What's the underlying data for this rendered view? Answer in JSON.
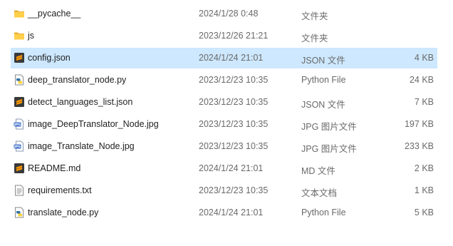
{
  "files": [
    {
      "name": "__pycache__",
      "date": "2024/1/28 0:48",
      "type": "文件夹",
      "size": "",
      "icon": "folder-icon",
      "selected": false
    },
    {
      "name": "js",
      "date": "2023/12/26 21:21",
      "type": "文件夹",
      "size": "",
      "icon": "folder-icon",
      "selected": false
    },
    {
      "name": "config.json",
      "date": "2024/1/24 21:01",
      "type": "JSON 文件",
      "size": "4 KB",
      "icon": "sublime-file-icon",
      "selected": true
    },
    {
      "name": "deep_translator_node.py",
      "date": "2023/12/23 10:35",
      "type": "Python File",
      "size": "24 KB",
      "icon": "python-file-icon",
      "selected": false
    },
    {
      "name": "detect_languages_list.json",
      "date": "2023/12/23 10:35",
      "type": "JSON 文件",
      "size": "7 KB",
      "icon": "sublime-file-icon",
      "selected": false
    },
    {
      "name": "image_DeepTranslator_Node.jpg",
      "date": "2023/12/23 10:35",
      "type": "JPG 图片文件",
      "size": "197 KB",
      "icon": "jpg-file-icon",
      "selected": false
    },
    {
      "name": "image_Translate_Node.jpg",
      "date": "2023/12/23 10:35",
      "type": "JPG 图片文件",
      "size": "233 KB",
      "icon": "jpg-file-icon",
      "selected": false
    },
    {
      "name": "README.md",
      "date": "2024/1/24 21:01",
      "type": "MD 文件",
      "size": "2 KB",
      "icon": "sublime-file-icon",
      "selected": false
    },
    {
      "name": "requirements.txt",
      "date": "2023/12/23 10:35",
      "type": "文本文档",
      "size": "1 KB",
      "icon": "text-file-icon",
      "selected": false
    },
    {
      "name": "translate_node.py",
      "date": "2024/1/24 21:01",
      "type": "Python File",
      "size": "5 KB",
      "icon": "python-file-icon",
      "selected": false
    }
  ]
}
